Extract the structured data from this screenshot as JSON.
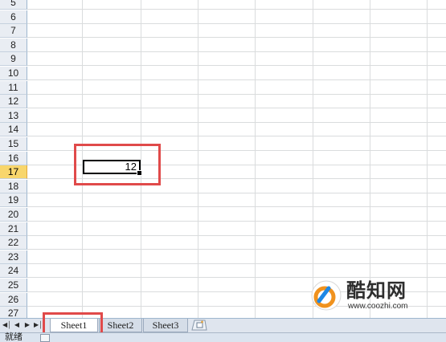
{
  "grid": {
    "row_numbers": [
      "5",
      "6",
      "7",
      "8",
      "9",
      "10",
      "11",
      "12",
      "13",
      "14",
      "15",
      "16",
      "17",
      "18",
      "19",
      "20",
      "21",
      "22",
      "23",
      "24",
      "25",
      "26",
      "27"
    ],
    "active_row": "17",
    "cell_value": "12"
  },
  "sheet_tabs": [
    {
      "label": "Sheet1",
      "active": true
    },
    {
      "label": "Sheet2",
      "active": false
    },
    {
      "label": "Sheet3",
      "active": false
    }
  ],
  "status_bar": {
    "text": "就绪"
  },
  "watermark": {
    "title": "酷知网",
    "url": "www.coozhi.com"
  },
  "colors": {
    "highlight": "#e04a4a",
    "active_row_header": "#f8d66c",
    "header_bg": "#e9edf3",
    "tab_bar_bg": "#dfe5ee"
  },
  "icons": {
    "nav_first": "first-sheet-icon",
    "nav_prev": "prev-sheet-icon",
    "nav_next": "next-sheet-icon",
    "nav_last": "last-sheet-icon",
    "new_sheet": "insert-worksheet-icon"
  }
}
